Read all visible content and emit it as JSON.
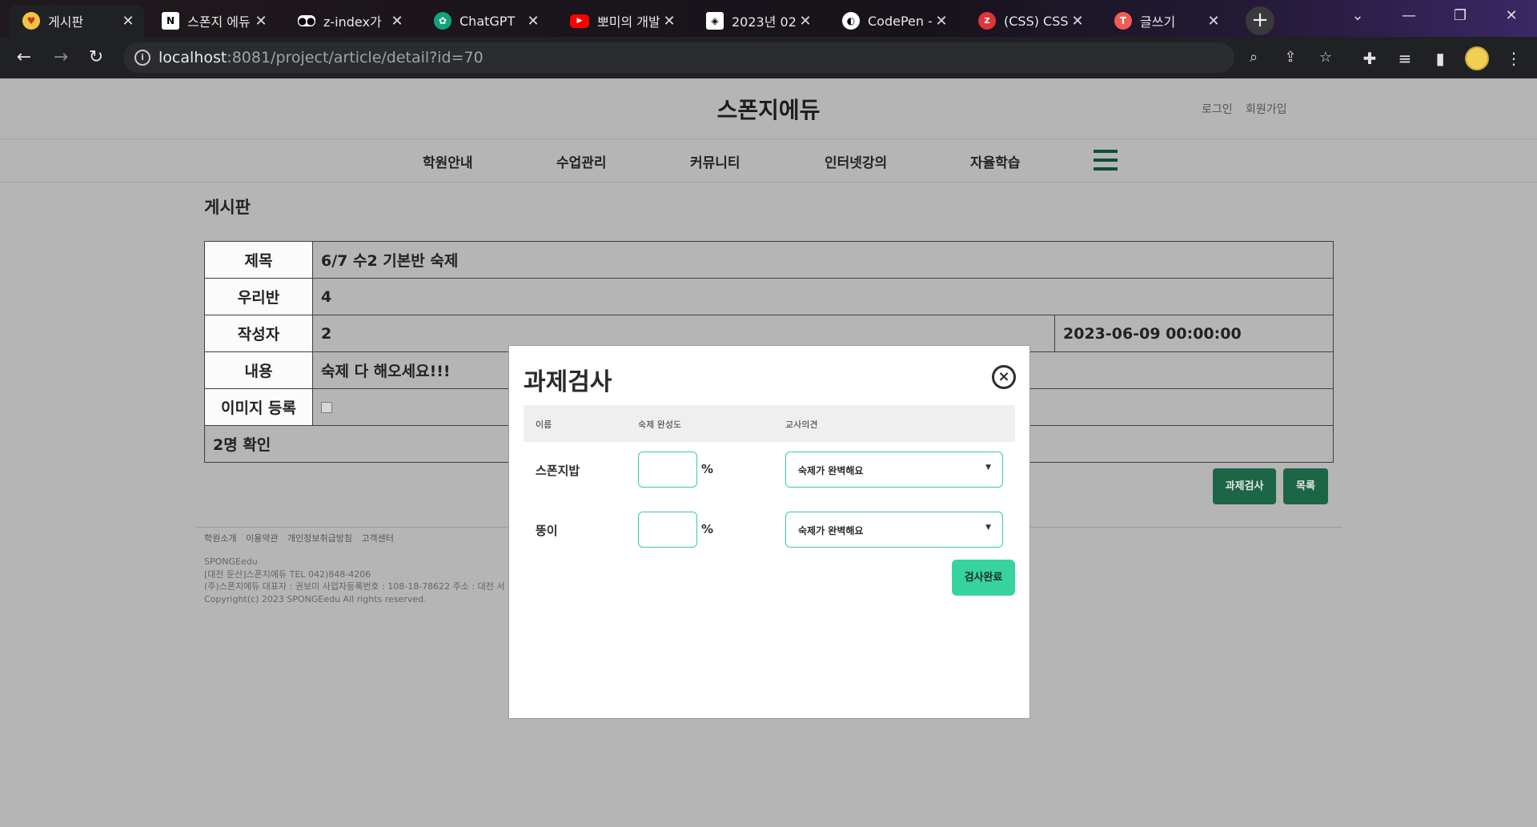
{
  "browser": {
    "tabs": [
      {
        "title": "게시판",
        "icon": "emoji-heart-eyes-icon",
        "color": "#f5c542"
      },
      {
        "title": "스폰지 에듀",
        "icon": "notion-icon",
        "color": "#ffffff"
      },
      {
        "title": "z-index가 ",
        "icon": "medium-icon",
        "color": "#ffffff"
      },
      {
        "title": "ChatGPT",
        "icon": "chatgpt-icon",
        "color": "#10a37f"
      },
      {
        "title": "뽀미의 개발",
        "icon": "youtube-icon",
        "color": "#ff0000"
      },
      {
        "title": "2023년 02",
        "icon": "codepen-icon",
        "color": "#ffffff"
      },
      {
        "title": "CodePen -",
        "icon": "codepen-globe-icon",
        "color": "#ffffff"
      },
      {
        "title": "(CSS) CSS",
        "icon": "zerocho-icon",
        "color": "#e0353c"
      },
      {
        "title": "글쓰기",
        "icon": "tistory-icon",
        "color": "#f25c54"
      }
    ],
    "url_host": "localhost",
    "url_rest": ":8081/project/article/detail?id=70"
  },
  "site": {
    "logo": "스폰지에듀",
    "login": "로그인",
    "signup": "회원가입",
    "nav": [
      "학원안내",
      "수업관리",
      "커뮤니티",
      "인터넷강의",
      "자율학습"
    ]
  },
  "board": {
    "title": "게시판",
    "rows": {
      "subject_label": "제목",
      "subject_value": "6/7 수2 기본반 숙제",
      "class_label": "우리반",
      "class_value": "4",
      "author_label": "작성자",
      "author_value": "2",
      "date_value": "2023-06-09 00:00:00",
      "content_label": "내용",
      "content_value": "숙제 다 해오세요!!!",
      "image_label": "이미지 등록",
      "confirm_text": "2명 확인"
    },
    "check_button": "과제검사",
    "list_button": "목록"
  },
  "footer": {
    "links": [
      "학원소개",
      "이용약관",
      "개인정보취급방침",
      "고객센터"
    ],
    "info": [
      "SPONGEedu",
      "[대전 둔산]스폰지에듀 TEL 042)848-4206",
      "(주)스폰지에듀 대표자 : 권보미 사업자등록번호 : 108-18-78622 주소 : 대전 서",
      "Copyright(c) 2023 SPONGEedu All rights reserved."
    ]
  },
  "modal": {
    "title": "과제검사",
    "close_symbol": "×",
    "headers": {
      "name": "이름",
      "completion": "숙제 완성도",
      "opinion": "교사의견"
    },
    "students": [
      {
        "name": "스폰지밥",
        "percent": "",
        "percent_sign": "%",
        "opinion": "숙제가 완벽해요"
      },
      {
        "name": "뚱이",
        "percent": "",
        "percent_sign": "%",
        "opinion": "숙제가 완벽해요"
      }
    ],
    "submit_button": "검사완료"
  },
  "colors": {
    "brand_green": "#1d6547",
    "accent_mint": "#36d3a0",
    "overlay_gray": "#b5b5b5"
  }
}
